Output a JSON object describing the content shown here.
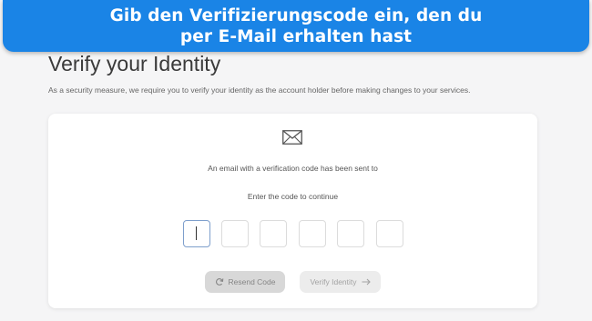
{
  "banner": {
    "line1": "Gib den Verifizierungscode ein, den du",
    "line2": "per E-Mail erhalten hast"
  },
  "page": {
    "title": "Verify your Identity",
    "description": "As a security measure, we require you to verify your identity as the account holder before making changes to your services."
  },
  "card": {
    "mail_icon": "envelope-icon",
    "sent_text": "An email with a verification code has been sent to",
    "enter_text": "Enter the code to continue",
    "code_digits": [
      "",
      "",
      "",
      "",
      "",
      ""
    ],
    "resend_label": "Resend Code",
    "resend_icon": "refresh-icon",
    "verify_label": "Verify Identity",
    "verify_icon": "arrow-right-icon"
  }
}
